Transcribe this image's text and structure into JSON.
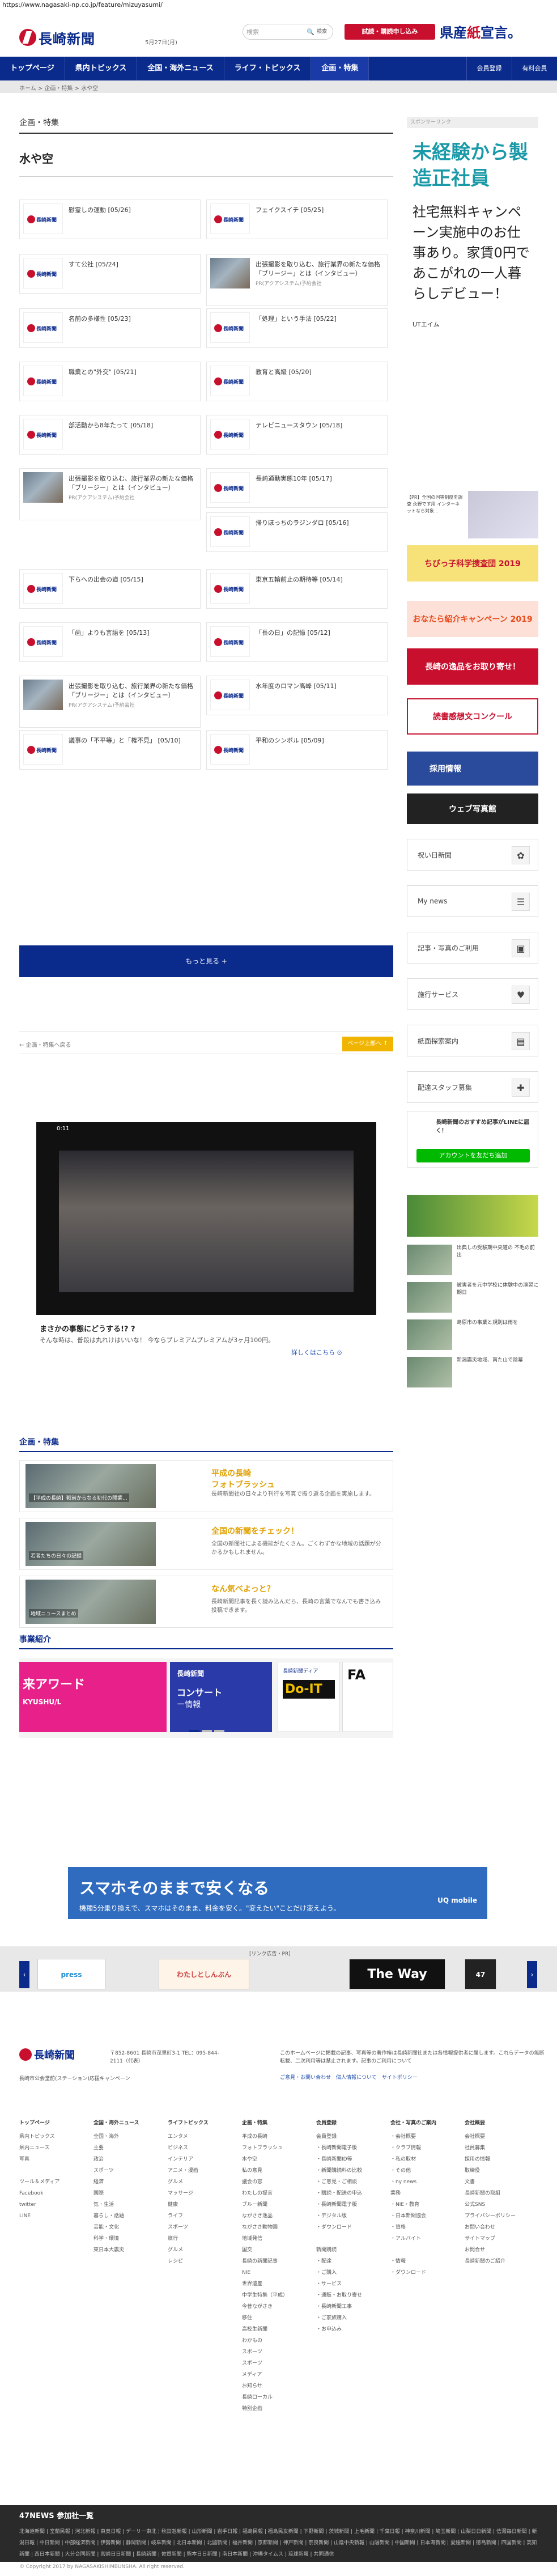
{
  "url": "https://www.nagasaki-np.co.jp/feature/mizuyasumi/",
  "header": {
    "logo": "長崎新聞",
    "date": "5月27日(月)",
    "search_ph": "検索",
    "search_btn": "検索",
    "trial": "試読・購読申し込み",
    "ken": "県産",
    "ken2": "紙",
    "ken3": "宣言。"
  },
  "nav": {
    "items": [
      "トップページ",
      "県内トピックス",
      "全国・海外ニュース",
      "ライフ・トピックス",
      "企画・特集"
    ],
    "login": "会員登録",
    "logout": "有料会員"
  },
  "breadcrumb": "ホーム > 企画・特集 > 水や空",
  "main": {
    "category": "企画・特集",
    "title": "水や空",
    "more": "もっと見る +",
    "back": "← 企画・特集へ戻る",
    "up": "ページ上部へ ↑"
  },
  "cards": [
    {
      "t": "慰霊しの運動 [05/26]",
      "img": "logo",
      "sub": ""
    },
    {
      "t": "フェイクスイチ [05/25]",
      "img": "logo",
      "sub": ""
    },
    {
      "t": "すて公社 [05/24]",
      "img": "logo",
      "sub": ""
    },
    {
      "t": "出張撮影を取り込む、旅行業界の新たな価格「ブリージー」とは（インタビュー）",
      "img": "photo",
      "sub": "PR(アクアシステム)予約会社"
    },
    {
      "t": "名前の多様性 [05/23]",
      "img": "logo",
      "sub": ""
    },
    {
      "t": "「処理」という手法 [05/22]",
      "img": "logo",
      "sub": ""
    },
    {
      "t": "職業との\"外交\" [05/21]",
      "img": "logo",
      "sub": ""
    },
    {
      "t": "教育と高級 [05/20]",
      "img": "logo",
      "sub": ""
    },
    {
      "t": "部活動から8年たって [05/18]",
      "img": "logo",
      "sub": ""
    },
    {
      "t": "テレビニュースタウン [05/18]",
      "img": "logo",
      "sub": ""
    },
    {
      "t": "出張撮影を取り込む、旅行業界の新たな価格「ブリージー」とは（インタビュー）",
      "img": "photo",
      "sub": "PR(アクアシステム)予約会社"
    },
    {
      "t": "長崎通勤実態10年 [05/17]",
      "img": "logo",
      "sub": ""
    },
    {
      "t": "帰りぼっちのラジンダロ [05/16]",
      "img": "logo",
      "sub": ""
    },
    {
      "t": "下らへの出会の道 [05/15]",
      "img": "logo",
      "sub": ""
    },
    {
      "t": "東京五輪前止の期待等 [05/14]",
      "img": "logo",
      "sub": ""
    },
    {
      "t": "「歯」よりも言語を [05/13]",
      "img": "logo",
      "sub": ""
    },
    {
      "t": "「長の日」の記憶 [05/12]",
      "img": "logo",
      "sub": ""
    },
    {
      "t": "出張撮影を取り込む、旅行業界の新たな価格「ブリージー」とは（インタビュー）",
      "img": "photo",
      "sub": "PR(アクアシステム)予約会社"
    },
    {
      "t": "水年度のロマン高峰 [05/11]",
      "img": "logo",
      "sub": ""
    },
    {
      "t": "議事の「不平等」と「権不見」 [05/10]",
      "img": "logo",
      "sub": ""
    },
    {
      "t": "平和のシンボル [05/09]",
      "img": "logo",
      "sub": ""
    }
  ],
  "video": {
    "time": "0:11",
    "cap1": "まさかの事態にどうする!? ?",
    "cap2": "そんな時は、普段は丸れけはいいな！ 今ならプレミアムプレミアムが3ヶ月100円。",
    "cta": "詳しくはこちら ⊙"
  },
  "features": {
    "title": "企画・特集",
    "rows": [
      {
        "caption": "【平成の長崎】戦前からなる初代の開業...",
        "t": "平成の長崎",
        "t2": "フォトブラッシュ",
        "d": "長崎新聞社の日々より刊行を写真で振り返る企画を実施します。"
      },
      {
        "caption": "若者たちの日々の記録",
        "t": "全国の新聞をチェック！",
        "t2": "",
        "d": "全国の新聞社による機能がたくさん。ごくわずかな地域の話題が分かるかもしれません。"
      },
      {
        "caption": "地域ニュースまとめ",
        "t": "なん気べよっと？",
        "t2": "",
        "d": "長崎新聞記事を長く読み込んだら、長崎の言葉でなんでも書き込み投稿できます。"
      }
    ]
  },
  "biz": {
    "title": "事業紹介",
    "s1": "来アワード",
    "s1b": "KYUSHU/L",
    "s2a": "長崎新聞",
    "s2b": "コンサート",
    "s2c": "ー情報",
    "s3a": "長崎新聞ディア",
    "s3b": "Do-IT",
    "s4": "FA"
  },
  "banner": {
    "a": "スマホそのままで安くなる",
    "b": "機種5分乗り換えで、スマホはそのまま、料金を安く。\"変えたい\"ことだけ変えよう。",
    "q": "UQ mobile"
  },
  "links": {
    "label": "[リンク広告・PR]",
    "items": [
      "press",
      "わたしとしんぶん",
      "The Way",
      "47"
    ]
  },
  "footer": {
    "logo": "長崎新聞",
    "addr": "〒852-8601 長崎市茂里町3-1 TEL：095-844-2111（代表）",
    "copy": "長崎市公会堂前(ステーション)応援キャンペーン",
    "note": "このホームページに掲載の記事、写真等の著作権は長崎新聞社または各情報提供者に属します。これらデータの無断転載、二次利用等は禁止されます。記事のご利用について",
    "note2": "ご意見・お問い合わせ　個人情報について　サイトポリシー",
    "cols": [
      {
        "h": "トップページ",
        "items": [
          "県内トピックス",
          "県内ニュース",
          "写真",
          "",
          "ツール＆メディア",
          "Facebook",
          "twitter",
          "LINE"
        ]
      },
      {
        "h": "全国・海外ニュース",
        "items": [
          "全国・海外",
          "主要",
          "政治",
          "スポーツ",
          "経済",
          "国際",
          "気・生活",
          "暮らし・話題",
          "芸能・文化",
          "科学・環境",
          "東日本大震災"
        ]
      },
      {
        "h": "ライフトピックス",
        "items": [
          "エンタメ",
          "ビジネス",
          "インテリア",
          "アニメ・漫画",
          "グルメ",
          "マッサージ",
          "健康",
          "ライフ",
          "スポーツ",
          "旅行",
          "グルメ",
          "レシピ"
        ]
      },
      {
        "h": "企画・特集",
        "items": [
          "平成の長崎",
          "フォトブラッシュ",
          "水や空",
          "私の意見",
          "議会の窓",
          "わたしの提言",
          "ブルー新聞",
          "ながさき逸品",
          "ながさき動物園",
          "地域発信",
          "国交",
          "長崎の新聞記事",
          "NIE",
          "世界遺産",
          "中学生特集（平成）",
          "今昔ながさき",
          "移住",
          "高校生新聞",
          "わかもの",
          "スポーツ",
          "スポーツ",
          "メディア",
          "お知らせ",
          "長崎ローカル",
          "特別企画"
        ]
      },
      {
        "h": "会員登録",
        "items": [
          "会員登録",
          "・長崎新聞電子版",
          "・長崎新聞ID等",
          "・新聞購読料の比較",
          "・ご意見・ご相談",
          "・購読・配送の申込",
          "・長崎新聞電子版",
          "・デジタル版",
          "・ダウンロード",
          "",
          "新聞購読",
          "・配達",
          "・ご購入",
          "・サービス",
          "・通販・お取り寄せ",
          "・長崎新聞工事",
          "・ご家族購入",
          "・お申込み"
        ]
      },
      {
        "h": "会社・写真のご案内",
        "items": [
          "・会社概要",
          "・クラブ情報",
          "・私の取材",
          "・その他",
          "・ny news",
          "業務",
          "・NIE・教育",
          "・日本新聞協会",
          "・資格",
          "・アルバイト",
          "",
          "・情報",
          "・ダウンロード"
        ]
      },
      {
        "h": "会社概要",
        "items": [
          "会社概要",
          "社員募集",
          "採用の情報",
          "取締役",
          "文書",
          "長崎新聞の取組",
          "公式SNS",
          "プライバシーポリシー",
          "お問い合わせ",
          "サイトマップ",
          "お問合せ",
          "長崎新聞のご紹介"
        ]
      }
    ]
  },
  "n47": {
    "title": "47NEWS 参加社一覧",
    "links": "北海道新聞 | 室蘭民報 | 河北新報 | 東奥日報 | デーリー東北 | 秋田魁新報 | 山形新聞 | 岩手日報 | 福島民報 | 福島民友新聞 | 下野新聞 | 茨城新聞 | 上毛新聞 | 千葉日報 | 神奈川新聞 | 埼玉新聞 | 山梨日日新聞 | 信濃毎日新聞 | 新潟日報 | 中日新聞 | 中部経済新聞 | 伊勢新聞 | 静岡新聞 | 岐阜新聞 | 北日本新聞 | 北國新聞 | 福井新聞 | 京都新聞 | 神戸新聞 | 奈良新聞 | 山陰中央新報 | 山陽新聞 | 中国新聞 | 日本海新聞 | 愛媛新聞 | 徳島新聞 | 四国新聞 | 高知新聞 | 西日本新聞 | 大分合同新聞 | 宮崎日日新聞 | 長崎新聞 | 佐賀新聞 | 熊本日日新聞 | 南日本新聞 | 沖縄タイムス | 琉球新報 | 共同通信"
  },
  "copyright": "© Copyright 2017 by NAGASAKISHIMBUNSHA. All right reserved.",
  "side": {
    "sponsor": "スポンサーリンク",
    "ad_a": "未経験から製造正社員",
    "ad_b": "社宅無料キャンペーン実施中のお仕事あり。家賃0円であこがれの一人暮らしデビュー！",
    "ad_c": "UTエイム",
    "ad2": "【PR】全国の同等制度を調査 永野です用 インターネットなら対象...",
    "b1": "ちびっ子科学捜査団 2019",
    "b2": "おなたら紹介キャンペーン 2019",
    "b3": "長崎の逸品をお取り寄せ！",
    "b4": "読書感想文コンクール",
    "b5": "採用情報",
    "b6": "ウェブ写真館",
    "menu": [
      "祝い日新聞",
      "My news",
      "記事・写真のご利用",
      "施行サービス",
      "紙面探索案内",
      "配達スタッフ募集"
    ],
    "line_t": "長崎新聞のおすすめ記事がLINEに届く！",
    "line_b": "アカウントを友だち追加",
    "news": [
      "出典しの受験期中央道の 不毛の前出",
      "被害者を元中学校に体験中の演習に期日",
      "島原市の事業と規則は雨を",
      "新潟震災地域、南た山で除幕"
    ]
  }
}
